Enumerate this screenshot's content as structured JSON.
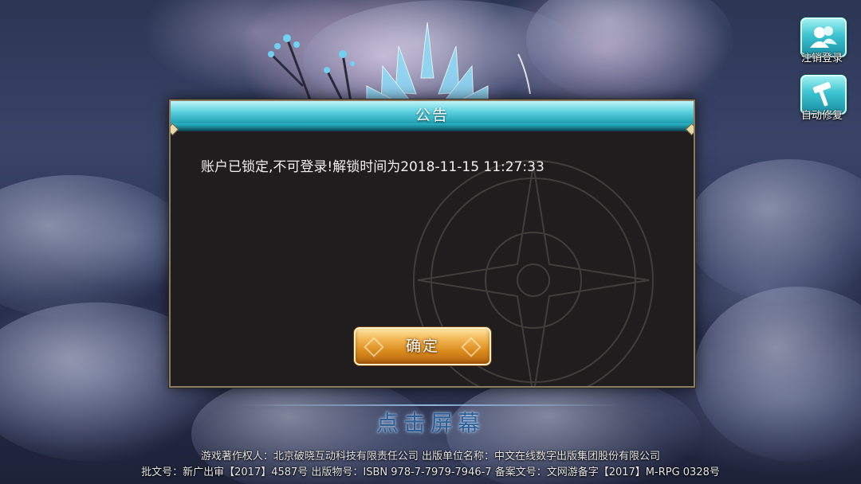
{
  "dialog": {
    "title": "公告",
    "message": "账户已锁定,不可登录!解锁时间为2018-11-15 11:27:33",
    "confirm_label": "确定"
  },
  "side_buttons": [
    {
      "label": "注销登录",
      "icon": "user-icon"
    },
    {
      "label": "自动修复",
      "icon": "hammer-icon"
    }
  ],
  "tap_screen": "点击屏幕",
  "footer": {
    "line1": "游戏著作权人：北京破晓互动科技有限责任公司  出版单位名称：中文在线数字出版集团股份有限公司",
    "line2": "批文号：新广出审【2017】4587号  出版物号：ISBN 978-7-7979-7946-7  备案文号：文网游备字【2017】M-RPG 0328号"
  },
  "colors": {
    "header_accent": "#29a8bb",
    "button_gold": "#d98a1c",
    "dialog_bg": "#1f1d1e",
    "side_button": "#3cc3d0"
  }
}
